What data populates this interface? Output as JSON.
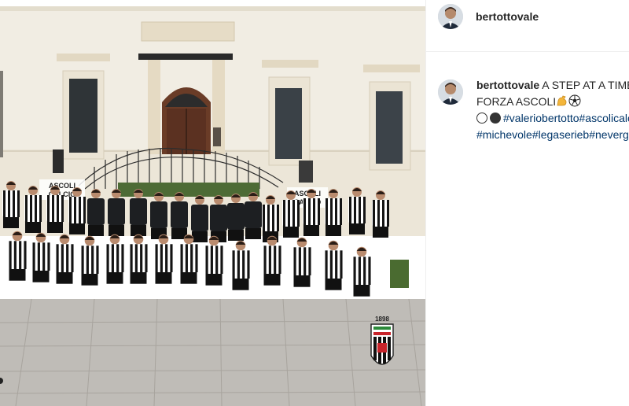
{
  "post": {
    "username": "bertottovale",
    "caption": {
      "text": "A STEP AT A TIME...",
      "line2": "FORZA ASCOLI",
      "hashtags": [
        "#valeriobertotto",
        "#ascolicalcio",
        "#michevole",
        "#legaserieb",
        "#nevergiveup"
      ]
    },
    "emoji": [
      "flexed-biceps",
      "soccer-ball",
      "white-circle",
      "black-circle"
    ]
  },
  "photo": {
    "sign_text_1": "ASCOLI",
    "sign_text_2": "CALCIO",
    "crest_year": "1898",
    "crest_label": "ASCOLI CALCIO"
  },
  "colors": {
    "hashtag": "#003569",
    "text": "#262626",
    "building": "#f1ede3",
    "ground": "#bfbcb7"
  }
}
